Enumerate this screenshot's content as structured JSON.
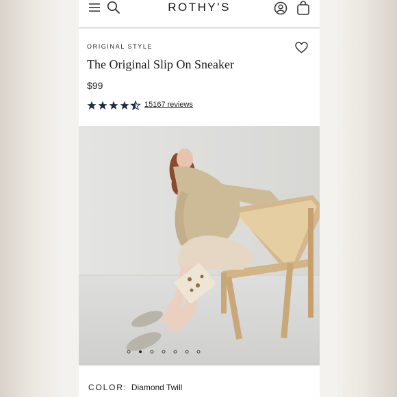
{
  "header": {
    "logo": "ROTHY'S",
    "icons": {
      "menu": "hamburger-menu-icon",
      "search": "search-icon",
      "account": "account-icon",
      "bag": "shopping-bag-icon"
    }
  },
  "product": {
    "eyebrow": "ORIGINAL STYLE",
    "title": "The Original Slip On Sneaker",
    "price": "$99",
    "rating": 4.5,
    "rating_max": 5,
    "reviews_label": "15167 reviews",
    "wishlist_icon": "heart-icon"
  },
  "gallery": {
    "slide_count": 7,
    "active_slide": 2
  },
  "color": {
    "label": "COLOR:",
    "value": "Diamond Twill"
  },
  "colors": {
    "accent": "#1f2a44",
    "text": "#1a1a1a",
    "background": "#ffffff"
  }
}
